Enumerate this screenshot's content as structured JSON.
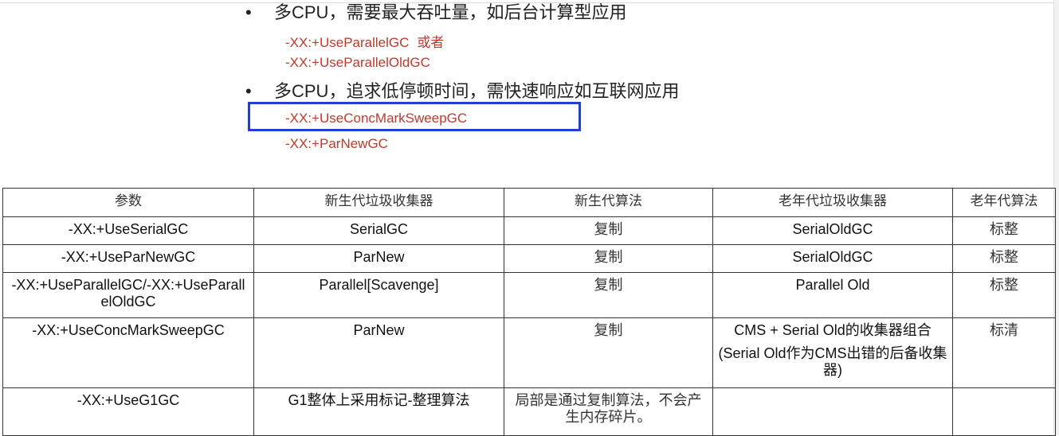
{
  "bullets": [
    {
      "text": "多CPU，需要最大吞吐量，如后台计算型应用",
      "options": [
        "-XX:+UseParallelGC",
        "-XX:+UseParallelOldGC"
      ],
      "option_suffix": "或者"
    },
    {
      "text": "多CPU，追求低停顿时间，需快速响应如互联网应用",
      "options": [
        "-XX:+UseConcMarkSweepGC",
        "-XX:+ParNewGC"
      ]
    }
  ],
  "table": {
    "headers": [
      "参数",
      "新生代垃圾收集器",
      "新生代算法",
      "老年代垃圾收集器",
      "老年代算法"
    ],
    "rows": [
      [
        "-XX:+UseSerialGC",
        "SerialGC",
        "复制",
        "SerialOldGC",
        "标整"
      ],
      [
        "-XX:+UseParNewGC",
        "ParNew",
        "复制",
        "SerialOldGC",
        "标整"
      ],
      [
        "-XX:+UseParallelGC/-XX:+UseParallelOldGC",
        "Parallel[Scavenge]",
        "复制",
        "Parallel Old",
        "标整"
      ],
      [
        "-XX:+UseConcMarkSweepGC",
        "ParNew",
        "复制",
        "CMS + Serial Old的收集器组合",
        "标清"
      ],
      [
        "-XX:+UseG1GC",
        "G1整体上采用标记-整理算法",
        "局部是通过复制算法，不会产生内存碎片。",
        "",
        ""
      ]
    ],
    "cms_note": "(Serial Old作为CMS出错的后备收集器)"
  }
}
